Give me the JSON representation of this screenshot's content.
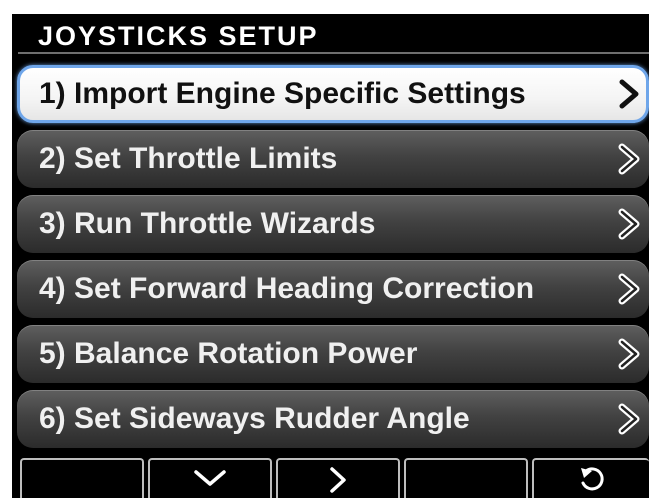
{
  "header": {
    "title": "JOYSTICKS SETUP"
  },
  "menu": {
    "items": [
      {
        "label": "1) Import Engine Specific Settings",
        "selected": true,
        "icon": "chevron-right-icon"
      },
      {
        "label": "2) Set Throttle Limits",
        "selected": false,
        "icon": "chevron-right-icon"
      },
      {
        "label": "3) Run Throttle Wizards",
        "selected": false,
        "icon": "chevron-right-icon"
      },
      {
        "label": "4) Set Forward Heading Correction",
        "selected": false,
        "icon": "chevron-right-icon"
      },
      {
        "label": "5) Balance Rotation Power",
        "selected": false,
        "icon": "chevron-right-icon"
      },
      {
        "label": "6) Set Sideways Rudder Angle",
        "selected": false,
        "icon": "chevron-right-icon"
      }
    ]
  },
  "softkeys": [
    {
      "name": "softkey-1",
      "icon": "none"
    },
    {
      "name": "softkey-down",
      "icon": "chevron-down-icon"
    },
    {
      "name": "softkey-select",
      "icon": "chevron-right-icon"
    },
    {
      "name": "softkey-4",
      "icon": "none"
    },
    {
      "name": "softkey-back",
      "icon": "return-icon"
    }
  ],
  "colors": {
    "background": "#000000",
    "selection_border": "#6fa6ea",
    "selected_fill": "#ffffff",
    "item_fill": "#424242",
    "text_light": "#f0f0f0",
    "text_dark": "#111111"
  }
}
